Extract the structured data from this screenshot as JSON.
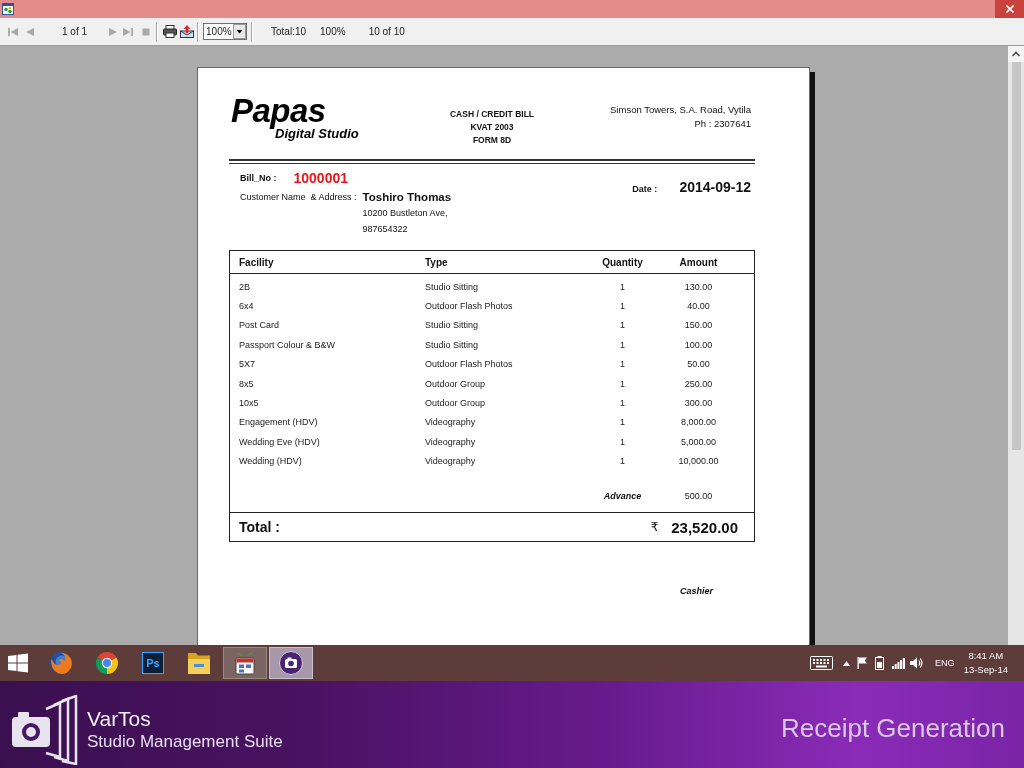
{
  "toolbar": {
    "nav_buttons": [
      {
        "disabled": true
      },
      {
        "disabled": true
      },
      {
        "disabled": true
      },
      {
        "disabled": true
      },
      {
        "disabled": true
      }
    ],
    "page_indicator": "1 of 1",
    "zoom_value": "100%",
    "total_text": "Total:10",
    "zoom_text": "100%",
    "record_count": "10 of 10"
  },
  "receipt": {
    "logo_title": "Papas",
    "logo_tagline": "Digital Studio",
    "bill_heading": [
      "CASH / CREDIT BILL",
      "KVAT 2003",
      "FORM 8D"
    ],
    "studio_address": [
      "Simson Towers, S.A. Road, Vytila",
      "Ph : 2307641"
    ],
    "bill_no_label": "Bill_No :",
    "bill_no": "1000001",
    "customer_label": "Customer Name  & Address :",
    "customer_name": "Toshiro Thomas",
    "customer_address": [
      "10200 Bustleton Ave,",
      "987654322"
    ],
    "date_label": "Date :",
    "date": "2014-09-12",
    "table": {
      "columns": [
        "Facility",
        "Type",
        "Quantity",
        "Amount"
      ],
      "rows": [
        {
          "facility": "2B",
          "type": "Studio Sitting",
          "quantity": "1",
          "amount": "130.00"
        },
        {
          "facility": "6x4",
          "type": "Outdoor Flash Photos",
          "quantity": "1",
          "amount": "40.00"
        },
        {
          "facility": "Post Card",
          "type": "Studio Sitting",
          "quantity": "1",
          "amount": "150.00"
        },
        {
          "facility": "Passport Colour & B&W",
          "type": "Studio Sitting",
          "quantity": "1",
          "amount": "100.00"
        },
        {
          "facility": "5X7",
          "type": "Outdoor Flash Photos",
          "quantity": "1",
          "amount": "50.00"
        },
        {
          "facility": "8x5",
          "type": "Outdoor Group",
          "quantity": "1",
          "amount": "250.00"
        },
        {
          "facility": "10x5",
          "type": "Outdoor Group",
          "quantity": "1",
          "amount": "300.00"
        },
        {
          "facility": "Engagement (HDV)",
          "type": "Videography",
          "quantity": "1",
          "amount": "8,000.00"
        },
        {
          "facility": "Wedding Eve (HDV)",
          "type": "Videography",
          "quantity": "1",
          "amount": "5,000.00"
        },
        {
          "facility": "Wedding (HDV)",
          "type": "Videography",
          "quantity": "1",
          "amount": "10,000.00"
        }
      ]
    },
    "advance_label": "Advance",
    "advance": "500.00",
    "total_label": "Total :",
    "currency_symbol": "₹",
    "total": "23,520.00",
    "cashier_label": "Cashier"
  },
  "taskbar": {
    "apps": [
      {
        "running": false,
        "selected": false
      },
      {
        "running": false,
        "selected": false
      },
      {
        "running": false,
        "selected": false,
        "icon_text": "Ps"
      },
      {
        "running": false,
        "selected": false
      },
      {
        "running": true,
        "selected": false
      },
      {
        "running": true,
        "selected": true
      }
    ],
    "language": "ENG",
    "time": "8:41 AM",
    "date": "13-Sep-14"
  },
  "banner": {
    "product_name": "VarTos",
    "product_subtitle": "Studio Management Suite",
    "screen_title": "Receipt Generation"
  }
}
